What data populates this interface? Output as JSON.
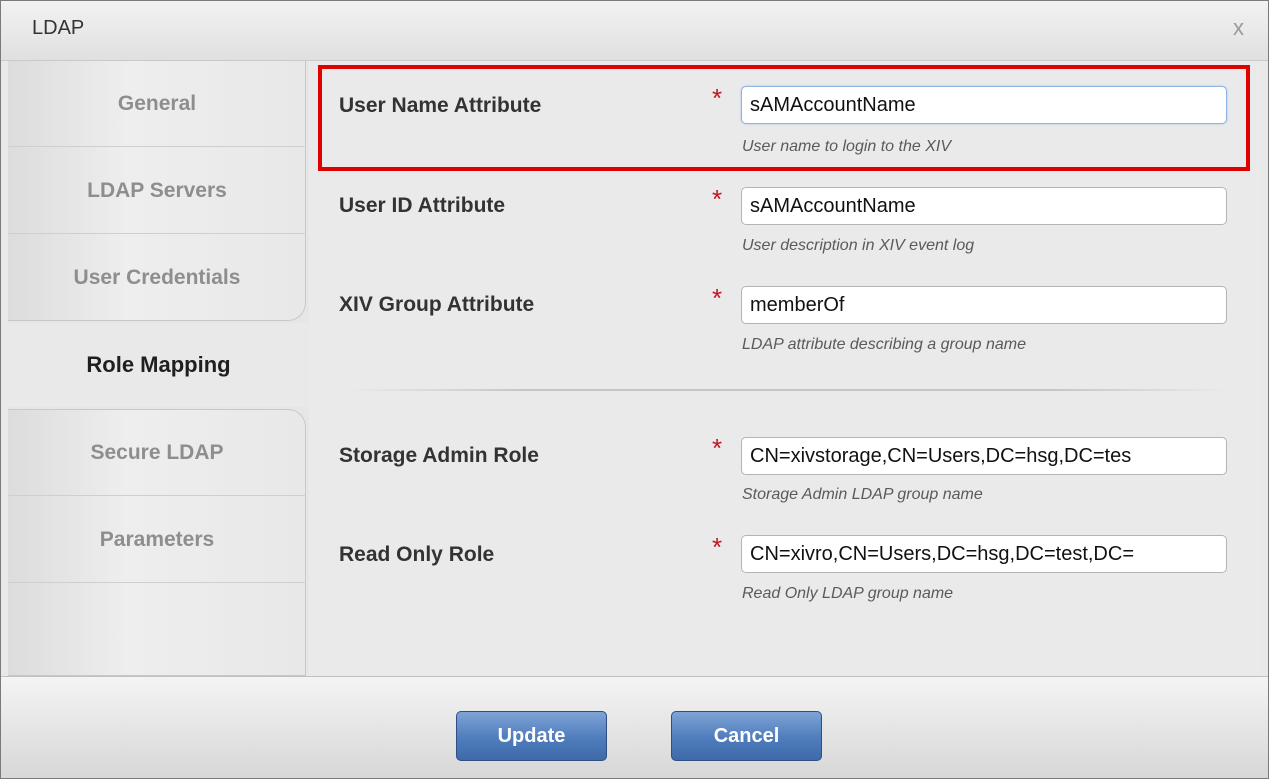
{
  "window": {
    "title": "LDAP",
    "close_label": "x"
  },
  "sidebar": {
    "tabs": [
      "General",
      "LDAP Servers",
      "User Credentials",
      "Role Mapping",
      "Secure LDAP",
      "Parameters"
    ],
    "active": "Role Mapping"
  },
  "form": {
    "required_mark": "*",
    "user_name_attribute": {
      "label": "User Name Attribute",
      "value": "sAMAccountName",
      "hint": "User name to login to the XIV"
    },
    "user_id_attribute": {
      "label": "User ID Attribute",
      "value": "sAMAccountName",
      "hint": "User description in XIV event log"
    },
    "xiv_group_attribute": {
      "label": "XIV Group Attribute",
      "value": "memberOf",
      "hint": "LDAP attribute describing a group name"
    },
    "storage_admin_role": {
      "label": "Storage Admin Role",
      "value": "CN=xivstorage,CN=Users,DC=hsg,DC=tes",
      "hint": "Storage Admin LDAP group name"
    },
    "read_only_role": {
      "label": "Read Only Role",
      "value": "CN=xivro,CN=Users,DC=hsg,DC=test,DC=",
      "hint": "Read Only LDAP group name"
    }
  },
  "footer": {
    "update_label": "Update",
    "cancel_label": "Cancel"
  },
  "colors": {
    "highlight": "#e00000",
    "required": "#c0171f",
    "button": "#4f7cbc"
  }
}
